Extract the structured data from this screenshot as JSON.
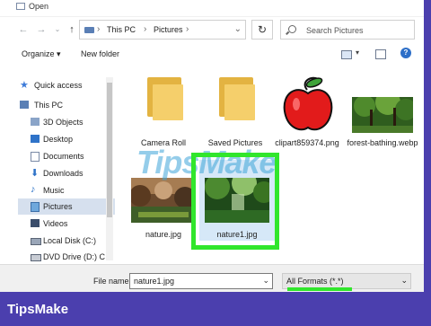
{
  "window": {
    "title": "Open"
  },
  "address": {
    "crumbs": [
      "This PC",
      "Pictures"
    ]
  },
  "search": {
    "placeholder": "Search Pictures"
  },
  "toolbar": {
    "organize": "Organize ▾",
    "new_folder": "New folder"
  },
  "sidebar": {
    "items": [
      {
        "label": "Quick access",
        "icon": "star-icon"
      },
      {
        "label": "This PC",
        "icon": "computer-icon"
      },
      {
        "label": "3D Objects",
        "icon": "cube-icon"
      },
      {
        "label": "Desktop",
        "icon": "desktop-icon"
      },
      {
        "label": "Documents",
        "icon": "documents-icon"
      },
      {
        "label": "Downloads",
        "icon": "download-icon"
      },
      {
        "label": "Music",
        "icon": "music-icon"
      },
      {
        "label": "Pictures",
        "icon": "pictures-icon"
      },
      {
        "label": "Videos",
        "icon": "videos-icon"
      },
      {
        "label": "Local Disk (C:)",
        "icon": "drive-icon"
      },
      {
        "label": "DVD Drive (D:) C",
        "icon": "dvd-icon"
      }
    ]
  },
  "files": [
    {
      "name": "Camera Roll",
      "type": "folder"
    },
    {
      "name": "Saved Pictures",
      "type": "folder"
    },
    {
      "name": "clipart859374.png",
      "type": "apple"
    },
    {
      "name": "forest-bathing.webp",
      "type": "forest"
    },
    {
      "name": "nature.jpg",
      "type": "nature"
    },
    {
      "name": "nature1.jpg",
      "type": "nature1"
    }
  ],
  "footer": {
    "file_name_label": "File name:",
    "file_name_value": "nature1.jpg",
    "file_type": "All Formats (*.*)"
  },
  "watermark": "TipsMake",
  "brand": "TipsMake",
  "colors": {
    "highlight": "#31e62c",
    "background": "#4b3fae",
    "selection": "#d6e0ee"
  }
}
